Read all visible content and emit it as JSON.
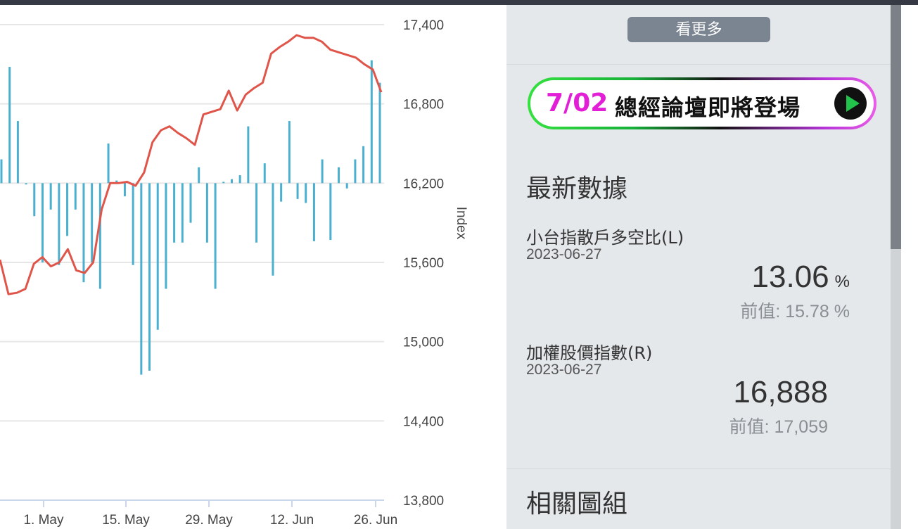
{
  "chart_data": {
    "type": "bar+line",
    "x_ticks": [
      "1. May",
      "15. May",
      "29. May",
      "12. Jun",
      "26. Jun"
    ],
    "yaxis_right": {
      "title": "Index",
      "ticks": [
        17400,
        16800,
        16200,
        15600,
        15000,
        14400,
        13800
      ],
      "range": [
        13800,
        17400
      ]
    },
    "bars": {
      "name": "小台指散戶多空比",
      "axis": "left",
      "color": "#4bb0cf",
      "baseline_index": 16200,
      "values_as_index": [
        16380,
        17080,
        16670,
        16190,
        15950,
        15600,
        16000,
        15580,
        15800,
        16000,
        15450,
        15600,
        15400,
        16500,
        16220,
        16100,
        15580,
        14750,
        14780,
        15090,
        15400,
        15750,
        15750,
        15900,
        16320,
        15750,
        15400,
        16210,
        16230,
        16260,
        16630,
        15750,
        16350,
        15500,
        16060,
        16670,
        16080,
        16050,
        15760,
        16380,
        15770,
        16320,
        16160,
        16380,
        16480,
        17130,
        16960
      ]
    },
    "line": {
      "name": "加權股價指數",
      "axis": "right",
      "color": "#e0554a",
      "values": [
        15620,
        15360,
        15370,
        15400,
        15590,
        15640,
        15570,
        15600,
        15700,
        15540,
        15520,
        15600,
        16000,
        16200,
        16200,
        16210,
        16180,
        16280,
        16510,
        16600,
        16630,
        16580,
        16540,
        16490,
        16720,
        16740,
        16760,
        16900,
        16750,
        16870,
        16920,
        16960,
        17180,
        17230,
        17270,
        17320,
        17300,
        17300,
        17270,
        17210,
        17190,
        17170,
        17150,
        17100,
        17060,
        16888
      ]
    }
  },
  "sidebar": {
    "more_button": "看更多",
    "banner": {
      "date": "7/02",
      "text": "總經論壇即將登場"
    },
    "latest_title": "最新數據",
    "items": [
      {
        "name": "小台指散戶多空比(L)",
        "date": "2023-06-27",
        "value": "13.06",
        "unit": "%",
        "prev_label": "前值:",
        "prev_value": "15.78 %"
      },
      {
        "name": "加權股價指數(R)",
        "date": "2023-06-27",
        "value": "16,888",
        "unit": "",
        "prev_label": "前值:",
        "prev_value": "17,059"
      }
    ],
    "related_title": "相關圖組"
  }
}
